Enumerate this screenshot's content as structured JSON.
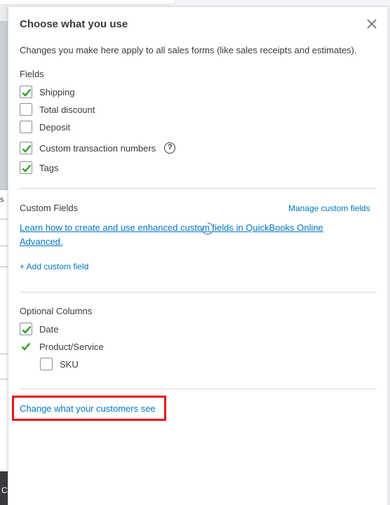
{
  "panel": {
    "title": "Choose what you use",
    "subtitle": "Changes you make here apply to all sales forms (like sales receipts and estimates)."
  },
  "fields": {
    "heading": "Fields",
    "items": [
      {
        "label": "Shipping",
        "checked": true
      },
      {
        "label": "Total discount",
        "checked": false
      },
      {
        "label": "Deposit",
        "checked": false
      },
      {
        "label": "Custom transaction numbers",
        "checked": true
      },
      {
        "label": "Tags",
        "checked": true
      }
    ],
    "help_glyph": "?"
  },
  "custom_fields": {
    "heading": "Custom Fields",
    "manage_link": "Manage custom fields",
    "learn_link": "Learn how to create and use enhanced custom fields in QuickBooks Online Advanced.",
    "add_link": "+ Add custom field"
  },
  "optional_columns": {
    "heading": "Optional Columns",
    "items": [
      {
        "label": "Date",
        "checked": true
      },
      {
        "label": "Product/Service",
        "checked": true
      },
      {
        "label": "SKU",
        "checked": false
      }
    ]
  },
  "footer": {
    "change_link": "Change what your customers see"
  },
  "background": {
    "left_glyph_top": "s",
    "left_glyph_bottom": "C"
  },
  "colors": {
    "check_green": "#2ca01c",
    "link_blue": "#0077c5",
    "highlight_red": "#e8121b"
  }
}
